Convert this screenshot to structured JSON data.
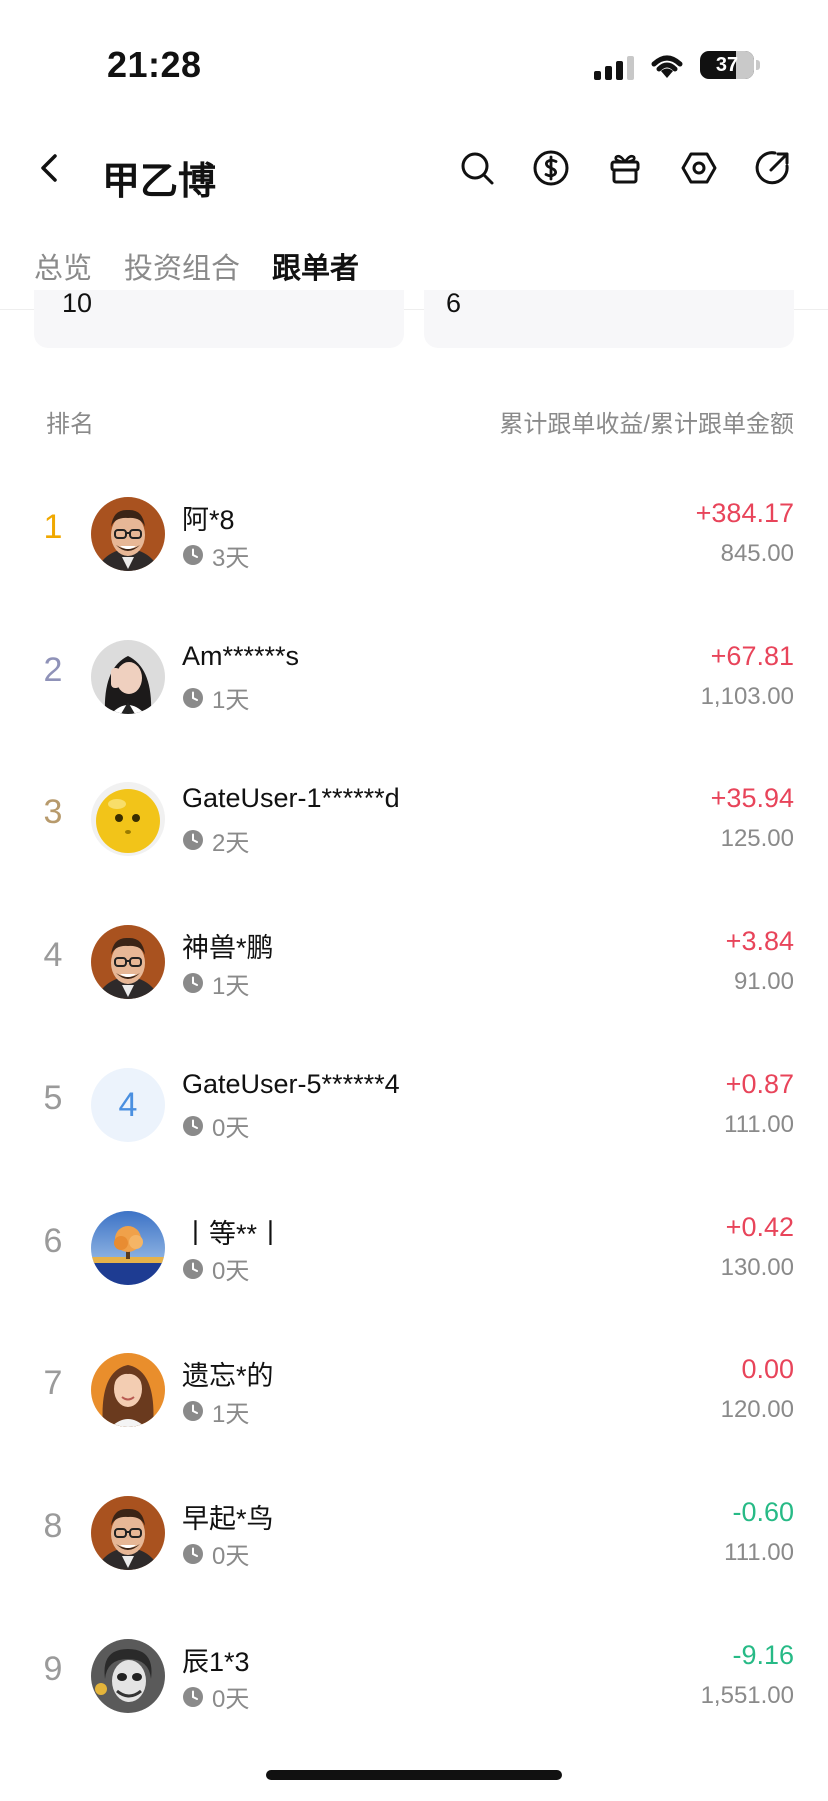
{
  "status_bar": {
    "time": "21:28",
    "battery": "37"
  },
  "header": {
    "title": "甲乙博"
  },
  "tabs": [
    {
      "label": "总览",
      "active": false
    },
    {
      "label": "投资组合",
      "active": false
    },
    {
      "label": "跟单者",
      "active": true
    }
  ],
  "summary": {
    "left_value": "10",
    "right_value": "6"
  },
  "list_header": {
    "rank_label": "排名",
    "value_label": "累计跟单收益/累计跟单金额"
  },
  "colors": {
    "gain": "#e8445a",
    "loss": "#27ba86",
    "gold": "#f0a800",
    "silver": "#8f92b8",
    "bronze": "#b79a6c",
    "rank_default": "#9a9a9a"
  },
  "followers": [
    {
      "rank": "1",
      "name": "阿*8",
      "days": "3天",
      "pnl": "+384.17",
      "amount": "845.00",
      "trend": "gain",
      "avatar": "man-glasses"
    },
    {
      "rank": "2",
      "name": "Am******s",
      "days": "1天",
      "pnl": "+67.81",
      "amount": "1,103.00",
      "trend": "gain",
      "avatar": "girl-photo"
    },
    {
      "rank": "3",
      "name": "GateUser-1******d",
      "days": "2天",
      "pnl": "+35.94",
      "amount": "125.00",
      "trend": "gain",
      "avatar": "yellow-toy"
    },
    {
      "rank": "4",
      "name": "神兽*鹏",
      "days": "1天",
      "pnl": "+3.84",
      "amount": "91.00",
      "trend": "gain",
      "avatar": "man-glasses"
    },
    {
      "rank": "5",
      "name": "GateUser-5******4",
      "days": "0天",
      "pnl": "+0.87",
      "amount": "111.00",
      "trend": "gain",
      "avatar": "letter",
      "avatar_letter": "4"
    },
    {
      "rank": "6",
      "name": "丨等**丨",
      "days": "0天",
      "pnl": "+0.42",
      "amount": "130.00",
      "trend": "gain",
      "avatar": "tree-landscape"
    },
    {
      "rank": "7",
      "name": "遗忘*的",
      "days": "1天",
      "pnl": "0.00",
      "amount": "120.00",
      "trend": "gain",
      "avatar": "woman-portrait"
    },
    {
      "rank": "8",
      "name": "早起*鸟",
      "days": "0天",
      "pnl": "-0.60",
      "amount": "111.00",
      "trend": "loss",
      "avatar": "man-glasses"
    },
    {
      "rank": "9",
      "name": "辰1*3",
      "days": "0天",
      "pnl": "-9.16",
      "amount": "1,551.00",
      "trend": "loss",
      "avatar": "joker-bw"
    }
  ]
}
